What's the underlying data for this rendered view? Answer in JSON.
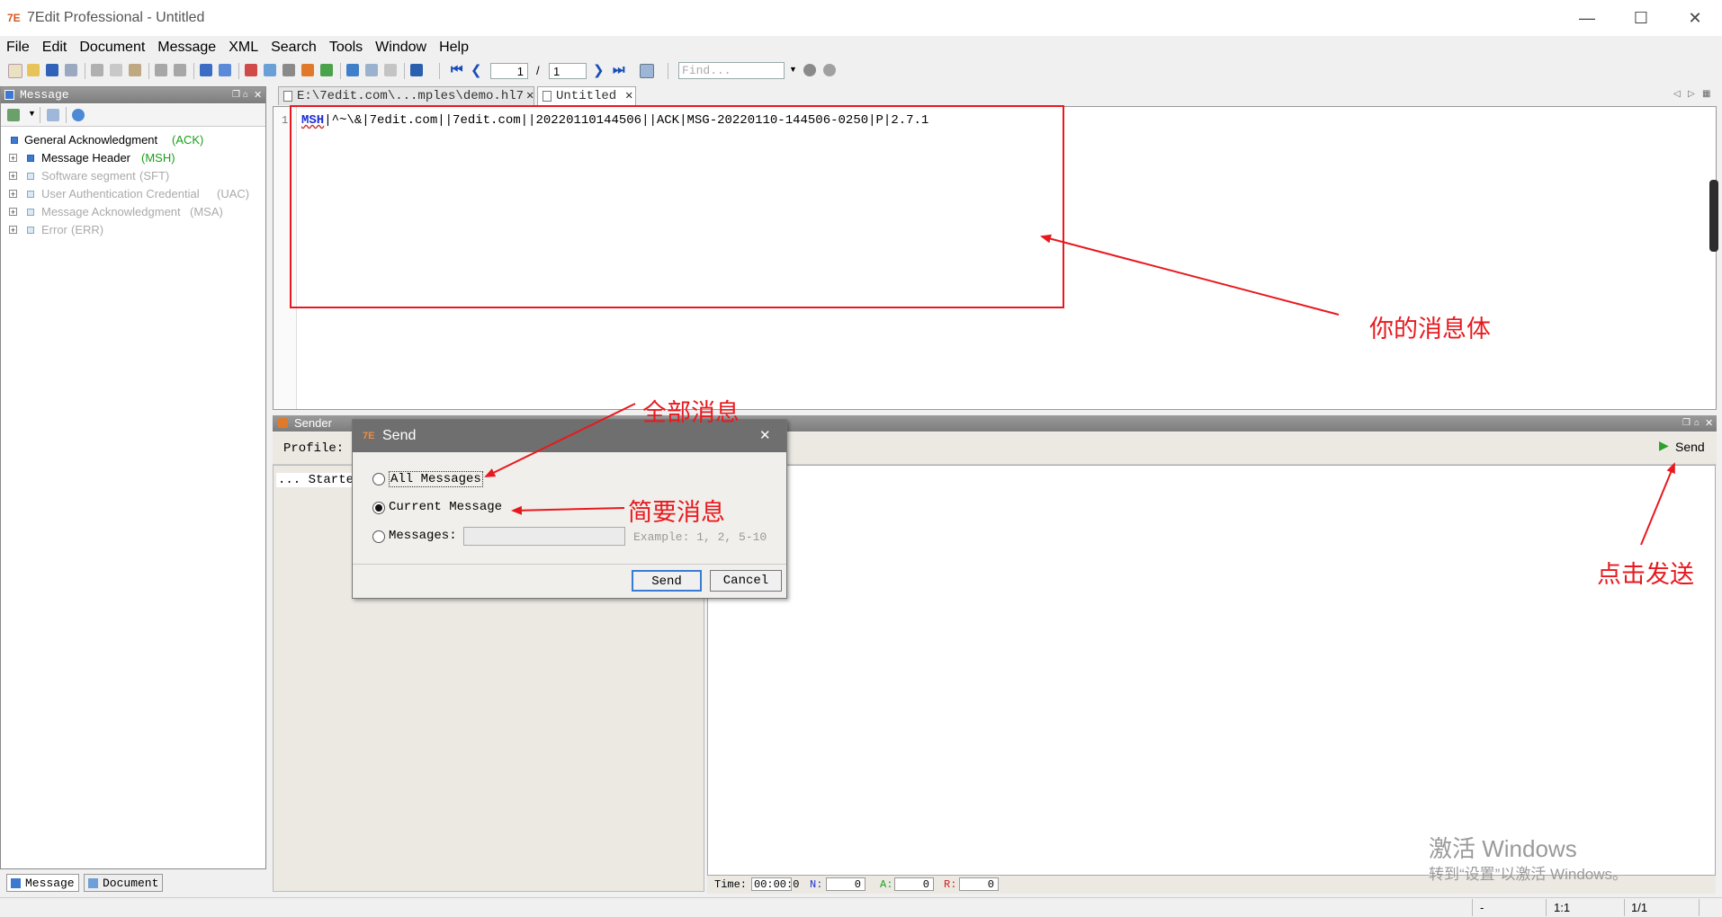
{
  "window": {
    "title": "7Edit Professional - Untitled",
    "logo": "7E",
    "minimize_glyph": "—",
    "maximize_glyph": "☐",
    "close_glyph": "✕"
  },
  "menu": [
    "File",
    "Edit",
    "Document",
    "Message",
    "XML",
    "Search",
    "Tools",
    "Window",
    "Help"
  ],
  "toolbar": {
    "page_current": "1",
    "page_separator": "/",
    "page_total": "1",
    "find_placeholder": "Find..."
  },
  "message_panel": {
    "title": "Message",
    "tree": [
      {
        "label": "General Acknowledgment",
        "code": "(ACK)",
        "enabled": true
      },
      {
        "label": "Message Header",
        "code": "(MSH)",
        "enabled": true
      },
      {
        "label": "Software segment",
        "code": "(SFT)",
        "enabled": false
      },
      {
        "label": "User Authentication Credential",
        "code": "(UAC)",
        "enabled": false
      },
      {
        "label": "Message Acknowledgment",
        "code": "(MSA)",
        "enabled": false
      },
      {
        "label": "Error",
        "code": "(ERR)",
        "enabled": false
      }
    ],
    "bottom_tabs": [
      "Message",
      "Document"
    ]
  },
  "editor": {
    "tabs": [
      "E:\\7edit.com\\...mples\\demo.hl7",
      "Untitled"
    ],
    "line_number": "1",
    "segment": "MSH",
    "content": "|^~\\&|7edit.com||7edit.com||20220110144506||ACK|MSG-20220110-144506-0250|P|2.7.1"
  },
  "sender": {
    "title": "Sender",
    "profile_label": "Profile:",
    "send_label": "Send",
    "log_text": "... Starte",
    "stats": {
      "time_label": "Time:",
      "time_value": "00:00:0",
      "n_label": "N:",
      "n_value": "0",
      "a_label": "A:",
      "a_value": "0",
      "r_label": "R:",
      "r_value": "0"
    }
  },
  "dialog": {
    "title": "Send",
    "close_glyph": "✕",
    "options": {
      "all": "All Messages",
      "current": "Current Message",
      "messages": "Messages:"
    },
    "selected": "current",
    "example_hint": "Example: 1, 2, 5-10",
    "send_button": "Send",
    "cancel_button": "Cancel"
  },
  "status_bar": {
    "mode": "-",
    "cursor": "1:1",
    "page": "1/1"
  },
  "annotations": {
    "message_body": "你的消息体",
    "all_messages": "全部消息",
    "brief_message": "简要消息",
    "click_send": "点击发送"
  },
  "watermark": {
    "line1": "激活 Windows",
    "line2": "转到“设置”以激活 Windows。"
  },
  "colors": {
    "annotation": "#e8191e",
    "segment": "#1c2fd4",
    "delimiter": "#d0407a",
    "enabled_code": "#19a019",
    "send_icon": "#2aa12a"
  }
}
